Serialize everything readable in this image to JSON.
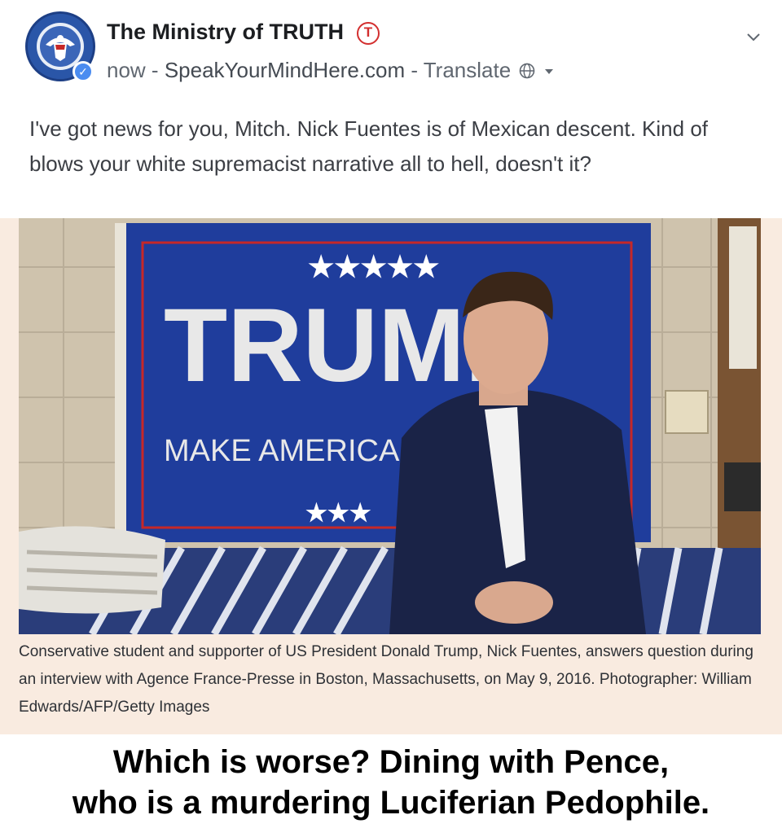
{
  "post": {
    "author_name": "The Ministry of TRUTH",
    "brand_badge": "T",
    "timestamp": "now",
    "separator_1": " - ",
    "source_site": "SpeakYourMindHere.com",
    "separator_2": " - ",
    "translate_label": "Translate",
    "text": "I've got news for you, Mitch. Nick Fuentes is of Mexican descent. Kind of blows your white supremacist narrative all to hell, doesn't it?"
  },
  "media": {
    "flag_word": "TRUMP",
    "flag_slogan": "MAKE AMERICA",
    "caption": "Conservative student and supporter of US President Donald Trump, Nick Fuentes, answers question during an interview with Agence France-Presse in Boston, Massachusetts, on May 9, 2016. Photographer: William Edwards/AFP/Getty Images"
  },
  "footer": {
    "line_1": "Which is worse? Dining with Pence,",
    "line_2": "who is a murdering Luciferian Pedophile."
  },
  "colors": {
    "brand_red": "#d32f2f",
    "verified_blue": "#4b8cf0",
    "media_background": "#f9ebe0",
    "flag_blue": "#1f3d9c"
  },
  "icons": [
    "seal-avatar-icon",
    "verified-icon",
    "brand-badge-icon",
    "globe-icon",
    "caret-down-icon",
    "chevron-down-icon"
  ]
}
